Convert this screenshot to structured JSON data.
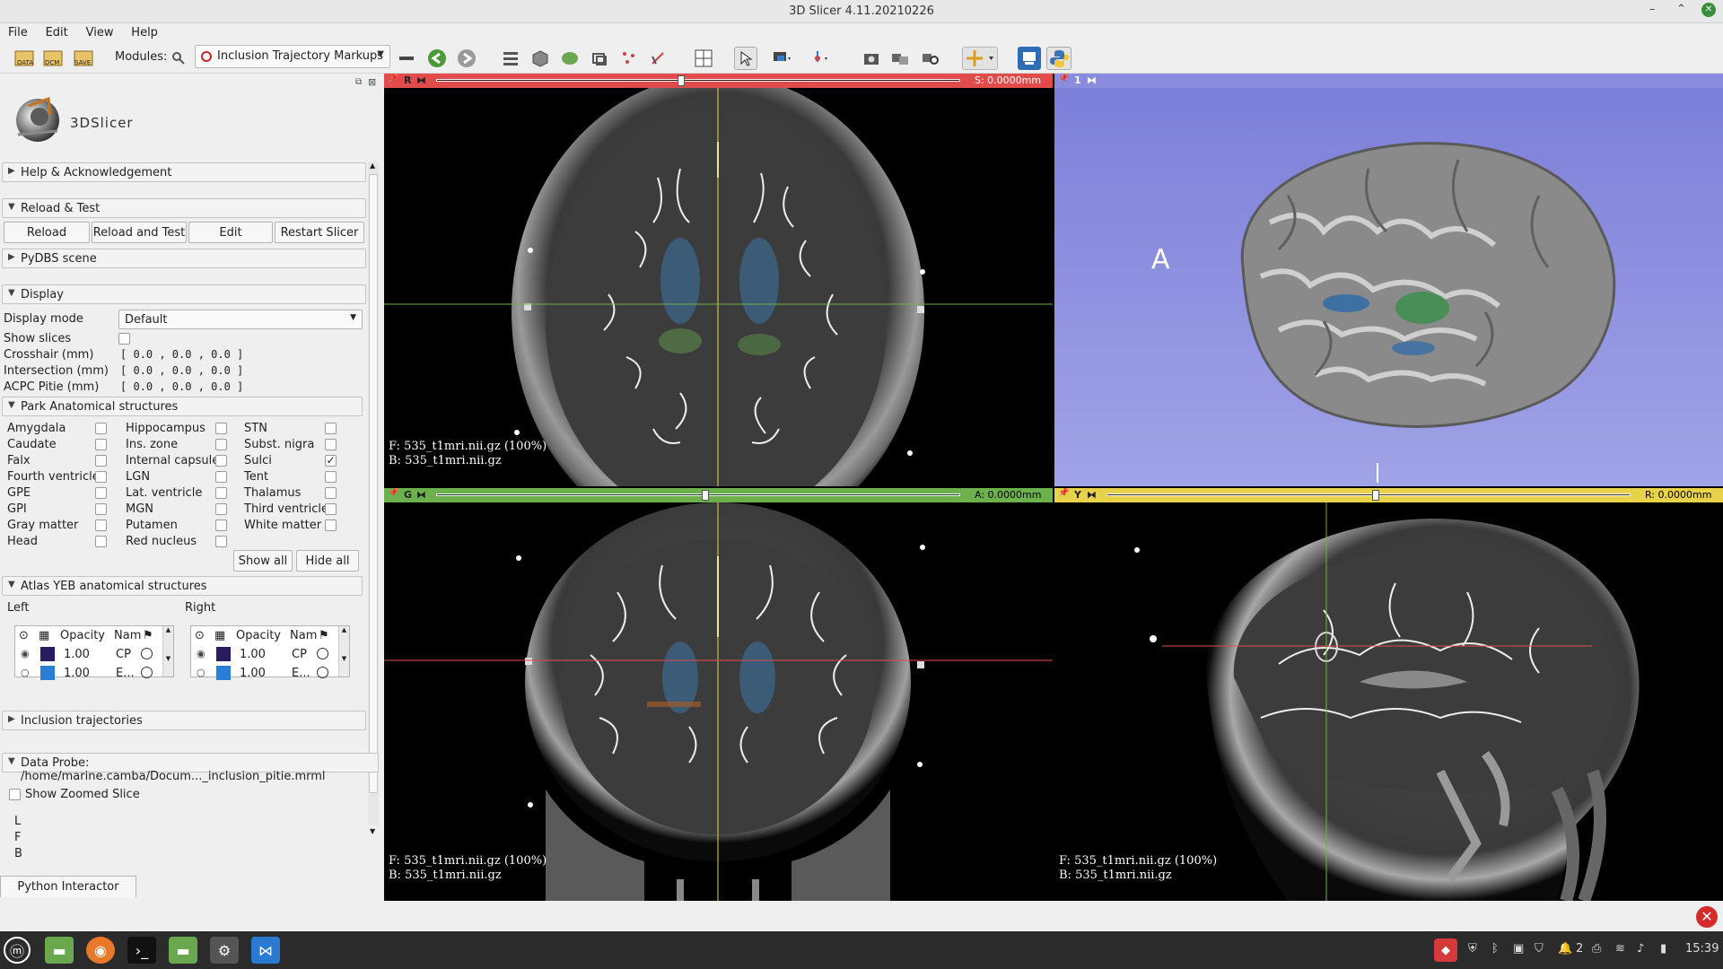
{
  "window": {
    "title": "3D Slicer 4.11.20210226",
    "minimize": "–",
    "maximize": "⌃",
    "close": "✕"
  },
  "menu": [
    "File",
    "Edit",
    "View",
    "Help"
  ],
  "toolbar": {
    "modules_label": "Modules:",
    "module_selected": "Inclusion Trajectory Markups",
    "icons": [
      "data-icon",
      "dcm-icon",
      "save-icon",
      "search-icon",
      "module-select",
      "toolbar-bar-icon",
      "back-icon",
      "forward-icon",
      "module-list-icon",
      "cube-icon",
      "sphere-icon",
      "transform-icon",
      "points-icon",
      "crop-icon",
      "layout-icon",
      "pointer-icon",
      "mouse-mode-icon",
      "fiducial-icon",
      "screenshot-icon",
      "scene-view-icon",
      "zoom-icon",
      "crosshair-icon",
      "extension-icon",
      "python-icon"
    ],
    "data_label": "DATA",
    "dcm_label": "DCM",
    "save_label": "SAVE"
  },
  "logo": {
    "text": "3DSlicer"
  },
  "sections": {
    "help": "Help & Acknowledgement",
    "reload": "Reload & Test",
    "pydbs": "PyDBS scene",
    "display": "Display",
    "park": "Park Anatomical structures",
    "atlas": "Atlas YEB anatomical structures",
    "inclusion": "Inclusion trajectories",
    "probe": "Data Probe: /home/marine.camba/Docum..._inclusion_pitie.mrml"
  },
  "reload_buttons": [
    "Reload",
    "Reload and Test",
    "Edit",
    "Restart Slicer"
  ],
  "display": {
    "mode_label": "Display mode",
    "mode_value": "Default",
    "show_slices_label": "Show slices",
    "crosshair_label": "Crosshair (mm)",
    "intersection_label": "Intersection (mm)",
    "acpc_label": "ACPC Pitie (mm)",
    "coord_text": "[  0.0    ,    0.0    ,    0.0   ]"
  },
  "park_structures": [
    {
      "label": "Amygdala",
      "checked": false
    },
    {
      "label": "Caudate",
      "checked": false
    },
    {
      "label": "Falx",
      "checked": false
    },
    {
      "label": "Fourth ventricle",
      "checked": false
    },
    {
      "label": "GPE",
      "checked": false
    },
    {
      "label": "GPI",
      "checked": false
    },
    {
      "label": "Gray matter",
      "checked": false
    },
    {
      "label": "Head",
      "checked": false
    },
    {
      "label": "Hippocampus",
      "checked": false
    },
    {
      "label": "Ins. zone",
      "checked": false
    },
    {
      "label": "Internal capsule",
      "checked": false
    },
    {
      "label": "LGN",
      "checked": false
    },
    {
      "label": "Lat. ventricle",
      "checked": false
    },
    {
      "label": "MGN",
      "checked": false
    },
    {
      "label": "Putamen",
      "checked": false
    },
    {
      "label": "Red nucleus",
      "checked": false
    },
    {
      "label": "STN",
      "checked": false
    },
    {
      "label": "Subst. nigra",
      "checked": false
    },
    {
      "label": "Sulci",
      "checked": true
    },
    {
      "label": "Tent",
      "checked": false
    },
    {
      "label": "Thalamus",
      "checked": false
    },
    {
      "label": "Third ventricle",
      "checked": false
    },
    {
      "label": "White matter",
      "checked": false
    }
  ],
  "park_buttons": {
    "show_all": "Show all",
    "hide_all": "Hide all"
  },
  "atlas": {
    "left_label": "Left",
    "right_label": "Right",
    "col_opacity": "Opacity",
    "col_name": "Nam",
    "left_rows": [
      {
        "opacity": "1.00",
        "name": "CP",
        "color": "#2a1a5e"
      },
      {
        "opacity": "1.00",
        "name": "E...",
        "color": "#2a7fd4"
      }
    ],
    "right_rows": [
      {
        "opacity": "1.00",
        "name": "CP",
        "color": "#2a1a5e"
      },
      {
        "opacity": "1.00",
        "name": "E...",
        "color": "#2a7fd4"
      }
    ]
  },
  "probe": {
    "zoom_label": "Show Zoomed Slice",
    "l": "L",
    "f": "F",
    "b": "B"
  },
  "python_tab": "Python Interactor",
  "views": {
    "red": {
      "letter": "R",
      "offset": "S: 0.0000mm",
      "f": "F: 535_t1mri.nii.gz (100%)",
      "b": "B: 535_t1mri.nii.gz",
      "color": "#e14b4b"
    },
    "three_d": {
      "letter": "1",
      "orient": "A"
    },
    "green": {
      "letter": "G",
      "offset": "A: 0.0000mm",
      "f": "F: 535_t1mri.nii.gz (100%)",
      "b": "B: 535_t1mri.nii.gz",
      "color": "#6cb14b"
    },
    "yellow": {
      "letter": "Y",
      "offset": "R: 0.0000mm",
      "f": "F: 535_t1mri.nii.gz (100%)",
      "b": "B: 535_t1mri.nii.gz",
      "color": "#e8d24a"
    }
  },
  "tray": {
    "clock": "15:39",
    "count": "2"
  }
}
